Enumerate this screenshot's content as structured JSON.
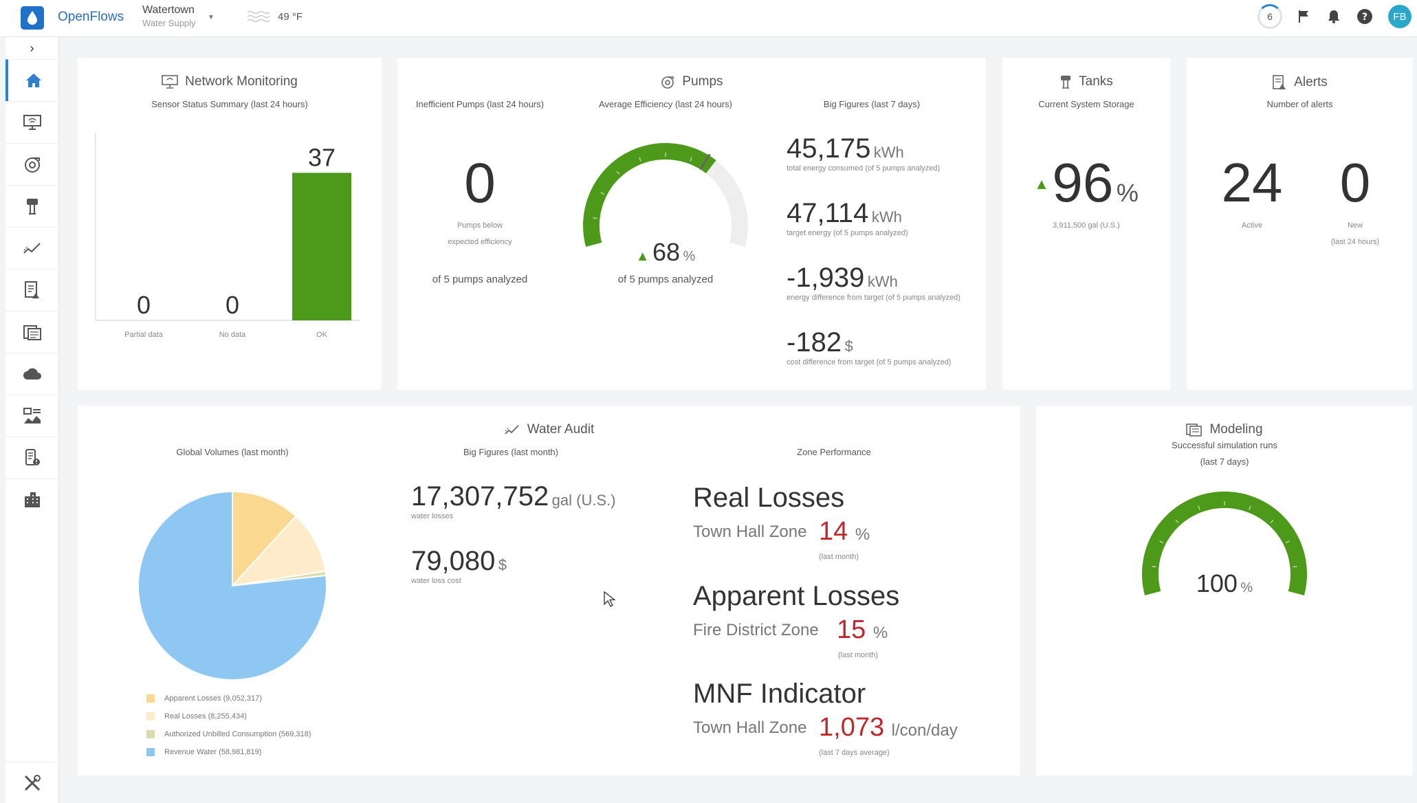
{
  "app": {
    "name": "OpenFlows",
    "location": "Watertown",
    "location_sub": "Water Supply",
    "temperature": "49 °F",
    "notif_count": "6",
    "user_initials": "FB"
  },
  "colors": {
    "accent": "#2f80d0",
    "green": "#4d9a1b",
    "red": "#c0272d"
  },
  "sidebar": {
    "items": [
      "home-icon",
      "network-monitoring-icon",
      "pumps-icon",
      "tanks-icon",
      "water-audit-icon",
      "alerts-icon",
      "modeling-icon",
      "cloud-icon",
      "reports-icon",
      "device-icon",
      "buildings-icon"
    ],
    "bottom": "tools-icon"
  },
  "network": {
    "title": "Network Monitoring",
    "subtitle": "Sensor Status Summary (last 24 hours)",
    "chart_data": {
      "type": "bar",
      "categories": [
        "Partial data",
        "No data",
        "OK"
      ],
      "values": [
        0,
        0,
        37
      ]
    }
  },
  "pumps": {
    "title": "Pumps",
    "inefficient": {
      "label": "Inefficient Pumps (last 24 hours)",
      "value": "0",
      "caption_1": "Pumps below",
      "caption_2": "expected efficiency",
      "analyzed": "of 5 pumps analyzed"
    },
    "avg_eff": {
      "label": "Average Efficiency (last 24 hours)",
      "value": "68",
      "unit": "%",
      "analyzed": "of 5 pumps analyzed",
      "gauge_fraction": 0.68
    },
    "big": {
      "label": "Big Figures (last 7 days)",
      "items": [
        {
          "value": "45,175",
          "unit": "kWh",
          "caption": "total energy consumed (of 5 pumps analyzed)"
        },
        {
          "value": "47,114",
          "unit": "kWh",
          "caption": "target energy (of 5 pumps analyzed)"
        },
        {
          "value": "-1,939",
          "unit": "kWh",
          "caption": "energy difference from target (of 5 pumps analyzed)"
        },
        {
          "value": "-182",
          "unit": "$",
          "caption": "cost difference from target (of 5 pumps analyzed)"
        }
      ]
    }
  },
  "tanks": {
    "title": "Tanks",
    "label": "Current System Storage",
    "value": "96",
    "unit": "%",
    "caption": "3,911,500 gal (U.S.)"
  },
  "alerts": {
    "title": "Alerts",
    "label": "Number of alerts",
    "active": "24",
    "active_label": "Active",
    "new": "0",
    "new_label": "New",
    "new_sub": "(last 24 hours)"
  },
  "audit": {
    "title": "Water Audit",
    "global_label": "Global Volumes (last month)",
    "chart_data": {
      "type": "pie",
      "slices": [
        {
          "name": "Apparent Losses (9,052,317)",
          "value": 9052317,
          "color": "#fbd990"
        },
        {
          "name": "Real Losses (8,255,434)",
          "value": 8255434,
          "color": "#fdebc9"
        },
        {
          "name": "Authorized Unbilled Consumption (569,318)",
          "value": 569318,
          "color": "#d9dcaa"
        },
        {
          "name": "Revenue Water (58,981,819)",
          "value": 58981819,
          "color": "#8ec8f2"
        }
      ]
    },
    "big_label": "Big Figures (last month)",
    "big": [
      {
        "value": "17,307,752",
        "unit": "gal (U.S.)",
        "caption": "water losses"
      },
      {
        "value": "79,080",
        "unit": "$",
        "caption": "water loss cost"
      }
    ],
    "zone_label": "Zone Performance",
    "zones": [
      {
        "heading": "Real Losses",
        "zone": "Town Hall Zone",
        "value": "14",
        "unit": "%",
        "note": "(last month)"
      },
      {
        "heading": "Apparent Losses",
        "zone": "Fire District Zone",
        "value": "15",
        "unit": "%",
        "note": "(last month)"
      },
      {
        "heading": "MNF Indicator",
        "zone": "Town Hall Zone",
        "value": "1,073",
        "unit": "l/con/day",
        "note": "(last 7 days average)"
      }
    ]
  },
  "modeling": {
    "title": "Modeling",
    "label_1": "Successful simulation runs",
    "label_2": "(last 7 days)",
    "value": "100",
    "unit": "%",
    "gauge_fraction": 1.0
  }
}
